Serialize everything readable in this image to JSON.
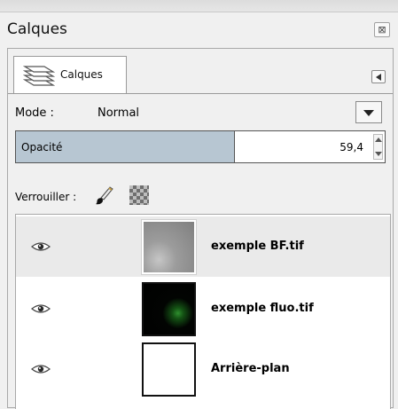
{
  "window": {
    "title": "Calques"
  },
  "tab": {
    "label": "Calques"
  },
  "mode": {
    "label": "Mode :",
    "value": "Normal"
  },
  "opacity": {
    "label": "Opacité",
    "value": "59,4",
    "fraction": 0.594
  },
  "lock": {
    "label": "Verrouiller :"
  },
  "layers": [
    {
      "name": "exemple BF.tif",
      "thumb": "bf",
      "visible": true,
      "selected": true
    },
    {
      "name": "exemple fluo.tif",
      "thumb": "fluo",
      "visible": true,
      "selected": false
    },
    {
      "name": "Arrière-plan",
      "thumb": "bg",
      "visible": true,
      "selected": false
    }
  ],
  "icons": {
    "close": "close-icon",
    "layers": "layers-stack-icon",
    "menu": "panel-menu-icon",
    "brush": "paintbrush-icon",
    "alpha": "checkerboard-alpha-icon",
    "eye": "eye-icon"
  },
  "colors": {
    "opacity_fill": "#b7c6d2",
    "selected_row": "#eaeaea"
  }
}
